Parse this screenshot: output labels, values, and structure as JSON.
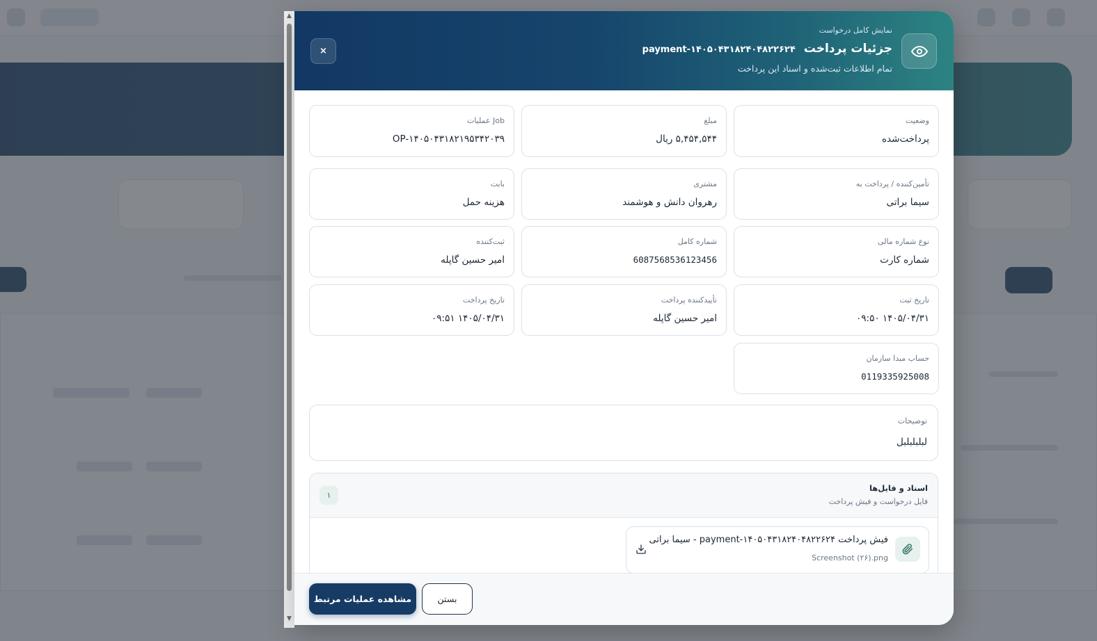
{
  "modal": {
    "kicker": "نمایش کامل درخواست",
    "title": "جزئیات پرداخت",
    "payment_id": "payment-۱۴۰۵۰۴۳۱۸۲۴۰۴۸۲۲۶۲۴",
    "subtitle": "تمام اطلاعات ثبت‌شده و اسناد این پرداخت",
    "close_label": "×"
  },
  "fields": {
    "status": {
      "label": "وضعیت",
      "value": "پرداخت‌شده"
    },
    "amount": {
      "label": "مبلغ",
      "value": "۵,۴۵۴,۵۴۴ ریال"
    },
    "job": {
      "label": "Job عملیات",
      "value": "OP-۱۴۰۵۰۴۳۱۸۲۱۹۵۳۴۲۰۳۹"
    },
    "payee": {
      "label": "تأمین‌کننده / پرداخت به",
      "value": "سیما براتی"
    },
    "customer": {
      "label": "مشتری",
      "value": "رهروان دانش و هوشمند"
    },
    "regarding": {
      "label": "بابت",
      "value": "هزینه حمل"
    },
    "account_type": {
      "label": "نوع شماره مالی",
      "value": "شماره کارت"
    },
    "full_number": {
      "label": "شماره کامل",
      "value": "6087568536123456"
    },
    "registrar": {
      "label": "ثبت‌کننده",
      "value": "امیر حسین گاپله"
    },
    "registered_at": {
      "label": "تاریخ ثبت",
      "value": "۱۴۰۵/۰۴/۳۱ ۰۹:۵۰"
    },
    "approver": {
      "label": "تأییدکننده پرداخت",
      "value": "امیر حسین گاپله"
    },
    "paid_at": {
      "label": "تاریخ پرداخت",
      "value": "۱۴۰۵/۰۴/۳۱ ۰۹:۵۱"
    },
    "source_account": {
      "label": "حساب مبدا سازمان",
      "value": "0119335925008"
    }
  },
  "description": {
    "label": "توضیحات",
    "value": "لبلبلبلبل"
  },
  "documents": {
    "title": "اسناد و فایل‌ها",
    "subtitle": "فایل درخواست و فیش پرداخت",
    "count": "۱",
    "files": [
      {
        "name": "فیش پرداخت payment-۱۴۰۵۰۴۳۱۸۲۴۰۴۸۲۲۶۲۴ - سیما براتی",
        "file": "Screenshot (۲۶).png"
      }
    ]
  },
  "footer": {
    "primary_label": "مشاهده عملیات مرتبط",
    "secondary_label": "بستن"
  },
  "colors": {
    "header_start": "#123863",
    "header_end": "#2c8382",
    "primary_button": "#163b65",
    "accent_green": "#2d6d5f"
  },
  "icons": {
    "header": "eye-icon",
    "close": "close-icon",
    "file": "paperclip-icon",
    "download": "download-icon"
  }
}
